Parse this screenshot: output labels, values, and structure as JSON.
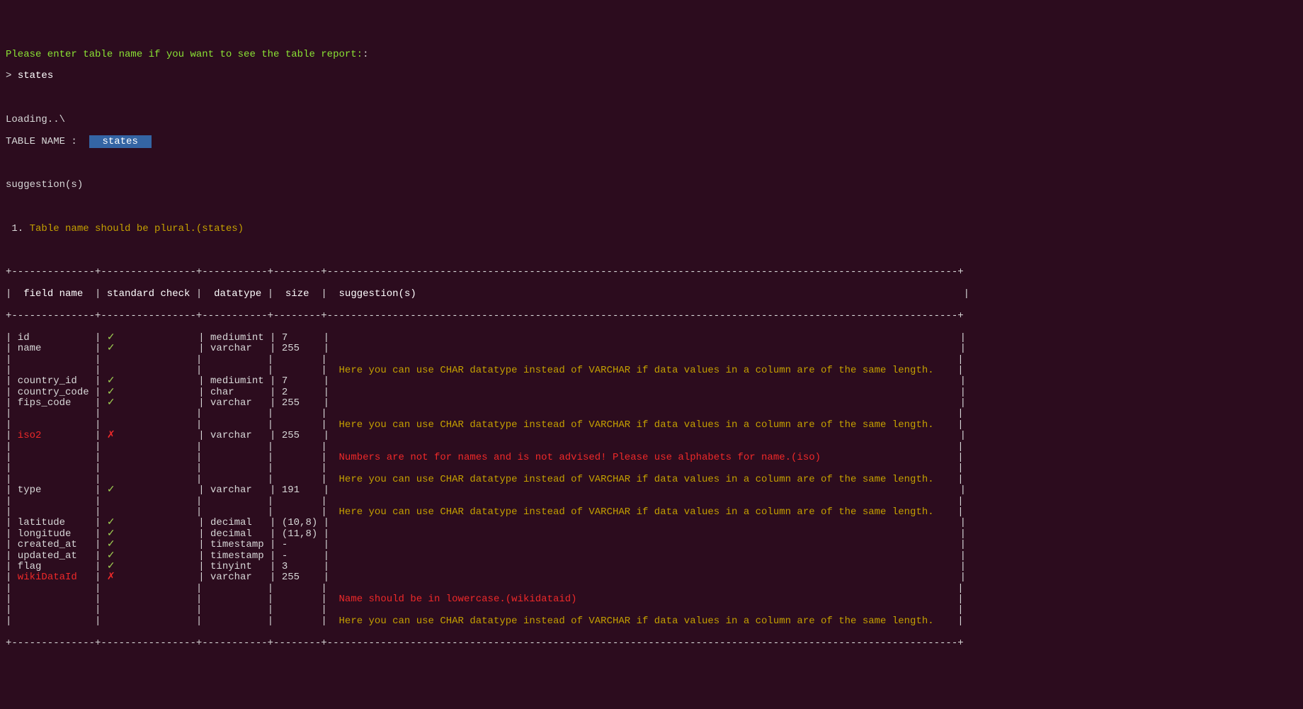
{
  "prompt": "Please enter table name if you want to see the table report:",
  "input_marker": "> ",
  "input_value": "states",
  "loading": "Loading..\\",
  "table_name_label": "TABLE NAME :",
  "table_name_value": "  states  ",
  "suggestion_header": "suggestion(s)",
  "suggestion_list": [
    {
      "num": "1.",
      "text": "Table name should be plural.(states)"
    }
  ],
  "hr": "+--------------+----------------+-----------+--------+----------------------------------------------------------------------------------------------------------+",
  "headers": {
    "field": "field name",
    "std": "standard check",
    "datatype": "datatype",
    "size": "size",
    "sugg": "suggestion(s)"
  },
  "char_hint": "Here you can use CHAR datatype instead of VARCHAR if data values in a column are of the same length.",
  "iso_hint": "Numbers are not for names and is not advised! Please use alphabets for name.(iso)",
  "lower_hint": "Name should be in lowercase.(wikidataid)",
  "rows": [
    {
      "field": "id",
      "field_err": false,
      "check": true,
      "datatype": "mediumint",
      "size": "7",
      "sugg_lines": []
    },
    {
      "field": "name",
      "field_err": false,
      "check": true,
      "datatype": "varchar",
      "size": "255",
      "sugg_lines": [
        "",
        "char"
      ]
    },
    {
      "field": "country_id",
      "field_err": false,
      "check": true,
      "datatype": "mediumint",
      "size": "7",
      "sugg_lines": []
    },
    {
      "field": "country_code",
      "field_err": false,
      "check": true,
      "datatype": "char",
      "size": "2",
      "sugg_lines": []
    },
    {
      "field": "fips_code",
      "field_err": false,
      "check": true,
      "datatype": "varchar",
      "size": "255",
      "sugg_lines": [
        "",
        "char"
      ]
    },
    {
      "field": "iso2",
      "field_err": true,
      "check": false,
      "datatype": "varchar",
      "size": "255",
      "sugg_lines": [
        "",
        "iso",
        "",
        "char"
      ]
    },
    {
      "field": "type",
      "field_err": false,
      "check": true,
      "datatype": "varchar",
      "size": "191",
      "sugg_lines": [
        "",
        "char"
      ]
    },
    {
      "field": "latitude",
      "field_err": false,
      "check": true,
      "datatype": "decimal",
      "size": "(10,8)",
      "sugg_lines": []
    },
    {
      "field": "longitude",
      "field_err": false,
      "check": true,
      "datatype": "decimal",
      "size": "(11,8)",
      "sugg_lines": []
    },
    {
      "field": "created_at",
      "field_err": false,
      "check": true,
      "datatype": "timestamp",
      "size": "-",
      "sugg_lines": []
    },
    {
      "field": "updated_at",
      "field_err": false,
      "check": true,
      "datatype": "timestamp",
      "size": "-",
      "sugg_lines": []
    },
    {
      "field": "flag",
      "field_err": false,
      "check": true,
      "datatype": "tinyint",
      "size": "3",
      "sugg_lines": []
    },
    {
      "field": "wikiDataId",
      "field_err": true,
      "check": false,
      "datatype": "varchar",
      "size": "255",
      "sugg_lines": [
        "",
        "lower",
        "",
        "char"
      ]
    }
  ]
}
